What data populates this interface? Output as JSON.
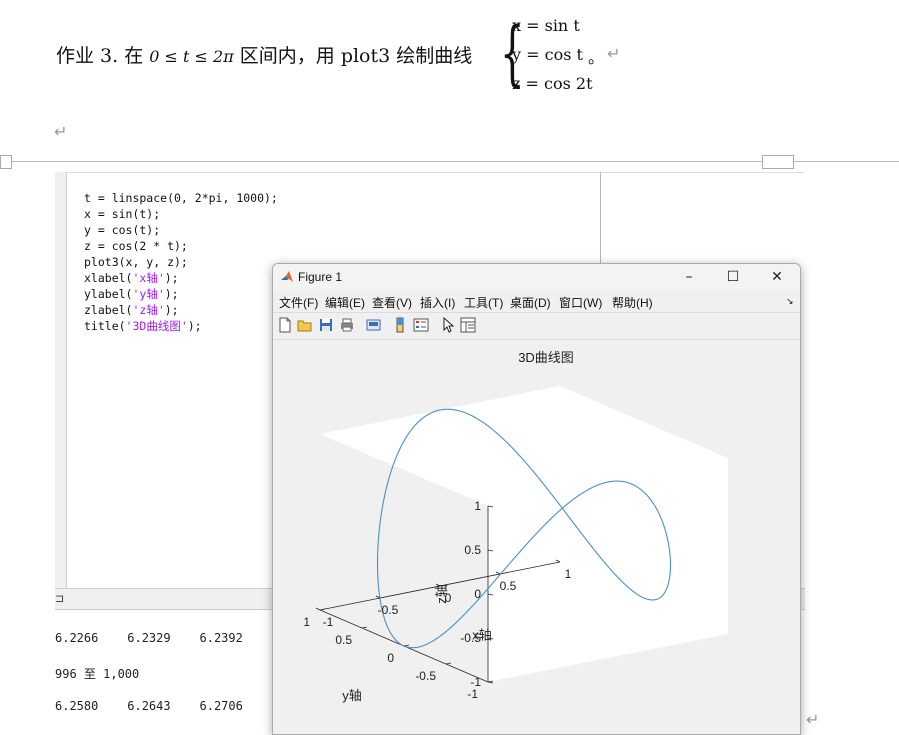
{
  "document": {
    "homework_prefix": "作业 3.  在",
    "range_expr": "0 ≤ t ≤ 2π",
    "homework_suffix": "区间内，用 plot3 绘制曲线",
    "eq_x": "x = sin t",
    "eq_y": "y = cos t",
    "eq_z": "z = cos 2t",
    "period": "。",
    "return_mark": "↵"
  },
  "editor": {
    "code_lines": [
      "t = linspace(0, 2*pi, 1000);",
      "x = sin(t);",
      "y = cos(t);",
      "z = cos(2 * t);",
      "plot3(x, y, z);"
    ],
    "label_lines": [
      {
        "pre": "xlabel(",
        "str": "'x轴'",
        "post": ");"
      },
      {
        "pre": "ylabel(",
        "str": "'y轴'",
        "post": ");"
      },
      {
        "pre": "zlabel(",
        "str": "'z轴'",
        "post": ");"
      },
      {
        "pre": "title(",
        "str": "'3D曲线图'",
        "post": ");"
      }
    ]
  },
  "command_window": {
    "row1": "6.2266    6.2329    6.2392",
    "row2": "996 至 1,000",
    "row3": "6.2580    6.2643    6.2706"
  },
  "figure": {
    "window_title": "Figure 1",
    "menus": [
      "文件(F)",
      "编辑(E)",
      "查看(V)",
      "插入(I)",
      "工具(T)",
      "桌面(D)",
      "窗口(W)",
      "帮助(H)"
    ],
    "colors": {
      "curve": "#4a90c8",
      "axes_bg": "#ffffff",
      "figure_bg": "#f0f0f0"
    }
  },
  "chart_data": {
    "type": "line",
    "title": "3D曲线图",
    "xlabel": "x轴",
    "ylabel": "y轴",
    "zlabel": "z轴",
    "xlim": [
      -1,
      1
    ],
    "ylim": [
      -1,
      1
    ],
    "zlim": [
      -1,
      1
    ],
    "x_ticks": [
      "-1",
      "-0.5",
      "0",
      "0.5",
      "1"
    ],
    "y_ticks": [
      "-1",
      "-0.5",
      "0",
      "0.5",
      "1"
    ],
    "z_ticks": [
      "-1",
      "-0.5",
      "0",
      "0.5",
      "1"
    ],
    "series": [
      {
        "x_expr": "sin(t)",
        "y_expr": "cos(t)",
        "z_expr": "cos(2*t)",
        "t_range": [
          0,
          6.283185307
        ],
        "points": 1000
      }
    ],
    "grid": false,
    "legend": "none"
  }
}
